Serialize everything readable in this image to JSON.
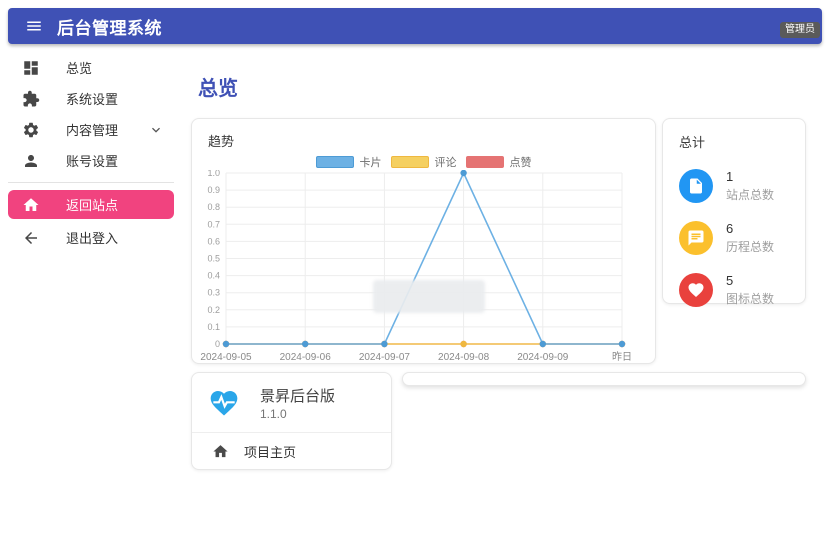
{
  "colors": {
    "header": "#3f51b5",
    "active_item": "#f1437f",
    "badge_bg": "#5a5a5a"
  },
  "header": {
    "title": "后台管理系统",
    "badge": "管理员"
  },
  "sidebar": {
    "items": [
      {
        "label": "总览",
        "icon": "dashboard-icon"
      },
      {
        "label": "系统设置",
        "icon": "extension-icon"
      },
      {
        "label": "内容管理",
        "icon": "settings-icon",
        "has_submenu": true
      },
      {
        "label": "账号设置",
        "icon": "person-icon"
      }
    ],
    "actions": [
      {
        "label": "返回站点",
        "icon": "home-icon",
        "active": true
      },
      {
        "label": "退出登入",
        "icon": "back-arrow-icon"
      }
    ]
  },
  "main": {
    "page_title": "总览"
  },
  "chart_card": {
    "title": "趋势"
  },
  "chart_data": {
    "type": "line",
    "title": "趋势",
    "x": [
      "2024-09-05",
      "2024-09-06",
      "2024-09-07",
      "2024-09-08",
      "2024-09-09",
      "昨日"
    ],
    "series": [
      {
        "name": "卡片",
        "color": "#6db1e4",
        "dot_color": "#4d9bd5",
        "values": [
          0,
          0,
          0,
          1,
          0,
          0
        ]
      },
      {
        "name": "评论",
        "color": "#f5d061",
        "dot_color": "#efb840",
        "values": [
          0,
          0,
          0,
          0,
          0,
          0
        ]
      },
      {
        "name": "点赞",
        "color": "#e57373",
        "dot_color": "#e57373",
        "values": [
          0,
          0,
          0,
          0,
          0,
          0
        ]
      }
    ],
    "ylim": [
      0,
      1
    ],
    "yticks": [
      "1.0",
      "0.9",
      "0.8",
      "0.7",
      "0.6",
      "0.5",
      "0.4",
      "0.3",
      "0.2",
      "0.1",
      "0"
    ],
    "grid": true,
    "legend_position": "top"
  },
  "totals_card": {
    "title": "总计",
    "stats": [
      {
        "value": "1",
        "label": "站点总数",
        "icon": "file-icon",
        "color": "#2196f3"
      },
      {
        "value": "6",
        "label": "历程总数",
        "icon": "chat-icon",
        "color": "#fbc02d"
      },
      {
        "value": "5",
        "label": "图标总数",
        "icon": "heart-icon",
        "color": "#e9413d"
      }
    ]
  },
  "app_card": {
    "name": "景昇后台版",
    "version": "1.1.0",
    "link_label": "项目主页"
  }
}
